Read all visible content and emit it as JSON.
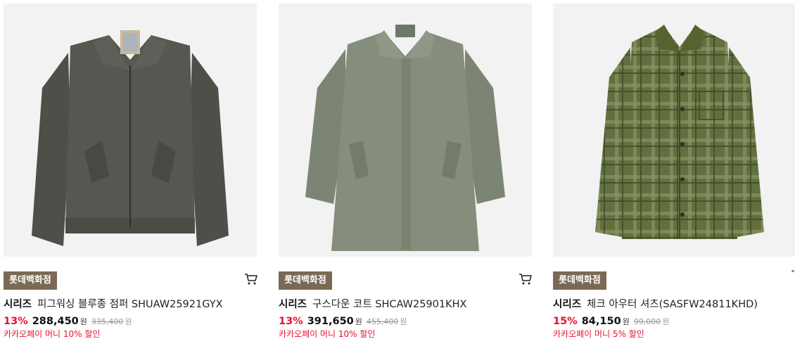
{
  "colors": {
    "badge_bg": "#7a6a55",
    "discount": "#e8112d",
    "benefit": "#e8112d",
    "thumb_bg": "#f2f2f2"
  },
  "products": [
    {
      "store": "롯데백화점",
      "brand": "시리즈",
      "name": "피그워싱 블루종 점퍼 SHUAW25921GYX",
      "discount": "13%",
      "price": "288,450",
      "currency": "원",
      "original_price": "335,400",
      "benefit": "카카오페이 머니 10% 할인",
      "image": "jacket-image",
      "cart_icon": "cart-icon"
    },
    {
      "store": "롯데백화점",
      "brand": "시리즈",
      "name": "구스다운 코트 SHCAW25901KHX",
      "discount": "13%",
      "price": "391,650",
      "currency": "원",
      "original_price": "455,400",
      "benefit": "카카오페이 머니 10% 할인",
      "image": "coat-image",
      "cart_icon": "cart-icon"
    },
    {
      "store": "롯데백화점",
      "brand": "시리즈",
      "name": "체크 아우터 셔츠(SASFW24811KHD)",
      "discount": "15%",
      "price": "84,150",
      "currency": "원",
      "original_price": "99,000",
      "benefit": "카카오페이 머니 5% 할인",
      "image": "shirt-image",
      "cart_icon": null
    }
  ]
}
